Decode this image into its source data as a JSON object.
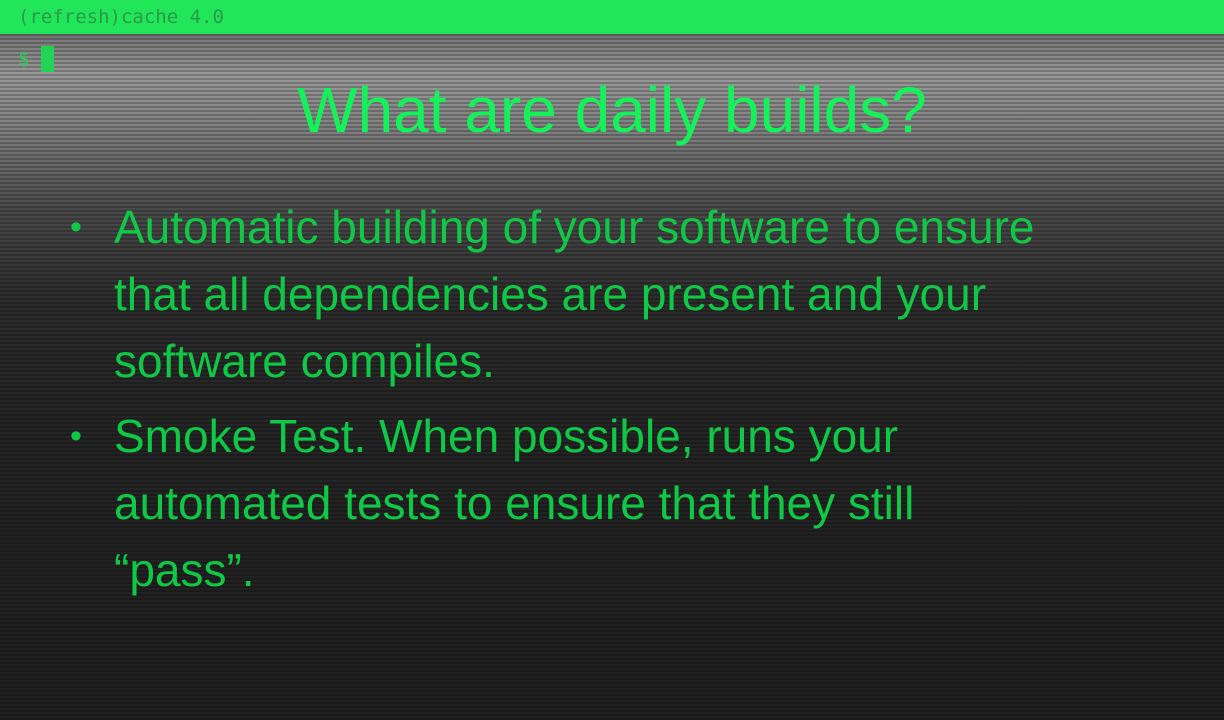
{
  "terminal": {
    "title": "(refresh)cache 4.0",
    "prompt": "$"
  },
  "slide": {
    "title": "What are daily builds?",
    "bullet_symbol": "•",
    "bullets": [
      {
        "lines": [
          "Automatic building of your software to ensure",
          "that all dependencies are present and your",
          "software compiles."
        ]
      },
      {
        "lines": [
          "Smoke Test. When possible, runs your",
          "automated tests to ensure that they still",
          "“pass”."
        ]
      }
    ]
  },
  "colors": {
    "accent_bar": "#22e65a",
    "title_text": "#14f25a",
    "body_text": "#10c846"
  }
}
